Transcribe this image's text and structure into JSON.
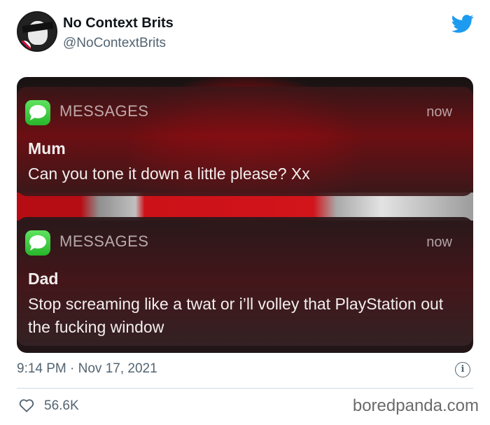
{
  "account": {
    "display_name": "No Context Brits",
    "handle": "@NoContextBrits"
  },
  "notifications": [
    {
      "app": "MESSAGES",
      "time": "now",
      "sender": "Mum",
      "text": "Can you tone it down a little please? Xx"
    },
    {
      "app": "MESSAGES",
      "time": "now",
      "sender": "Dad",
      "text": "Stop screaming like a twat or i’ll volley that PlayStation out the fucking window"
    }
  ],
  "tweet": {
    "timestamp": "9:14 PM · Nov 17, 2021",
    "likes": "56.6K"
  },
  "watermark": "boredpanda.com",
  "icons": {
    "brand": "twitter-bird-icon",
    "app": "messages-icon",
    "info": "info-icon",
    "like": "heart-icon"
  },
  "colors": {
    "twitter_blue": "#1d9bf0",
    "secondary_text": "#536471",
    "messages_green": "#34c759"
  }
}
